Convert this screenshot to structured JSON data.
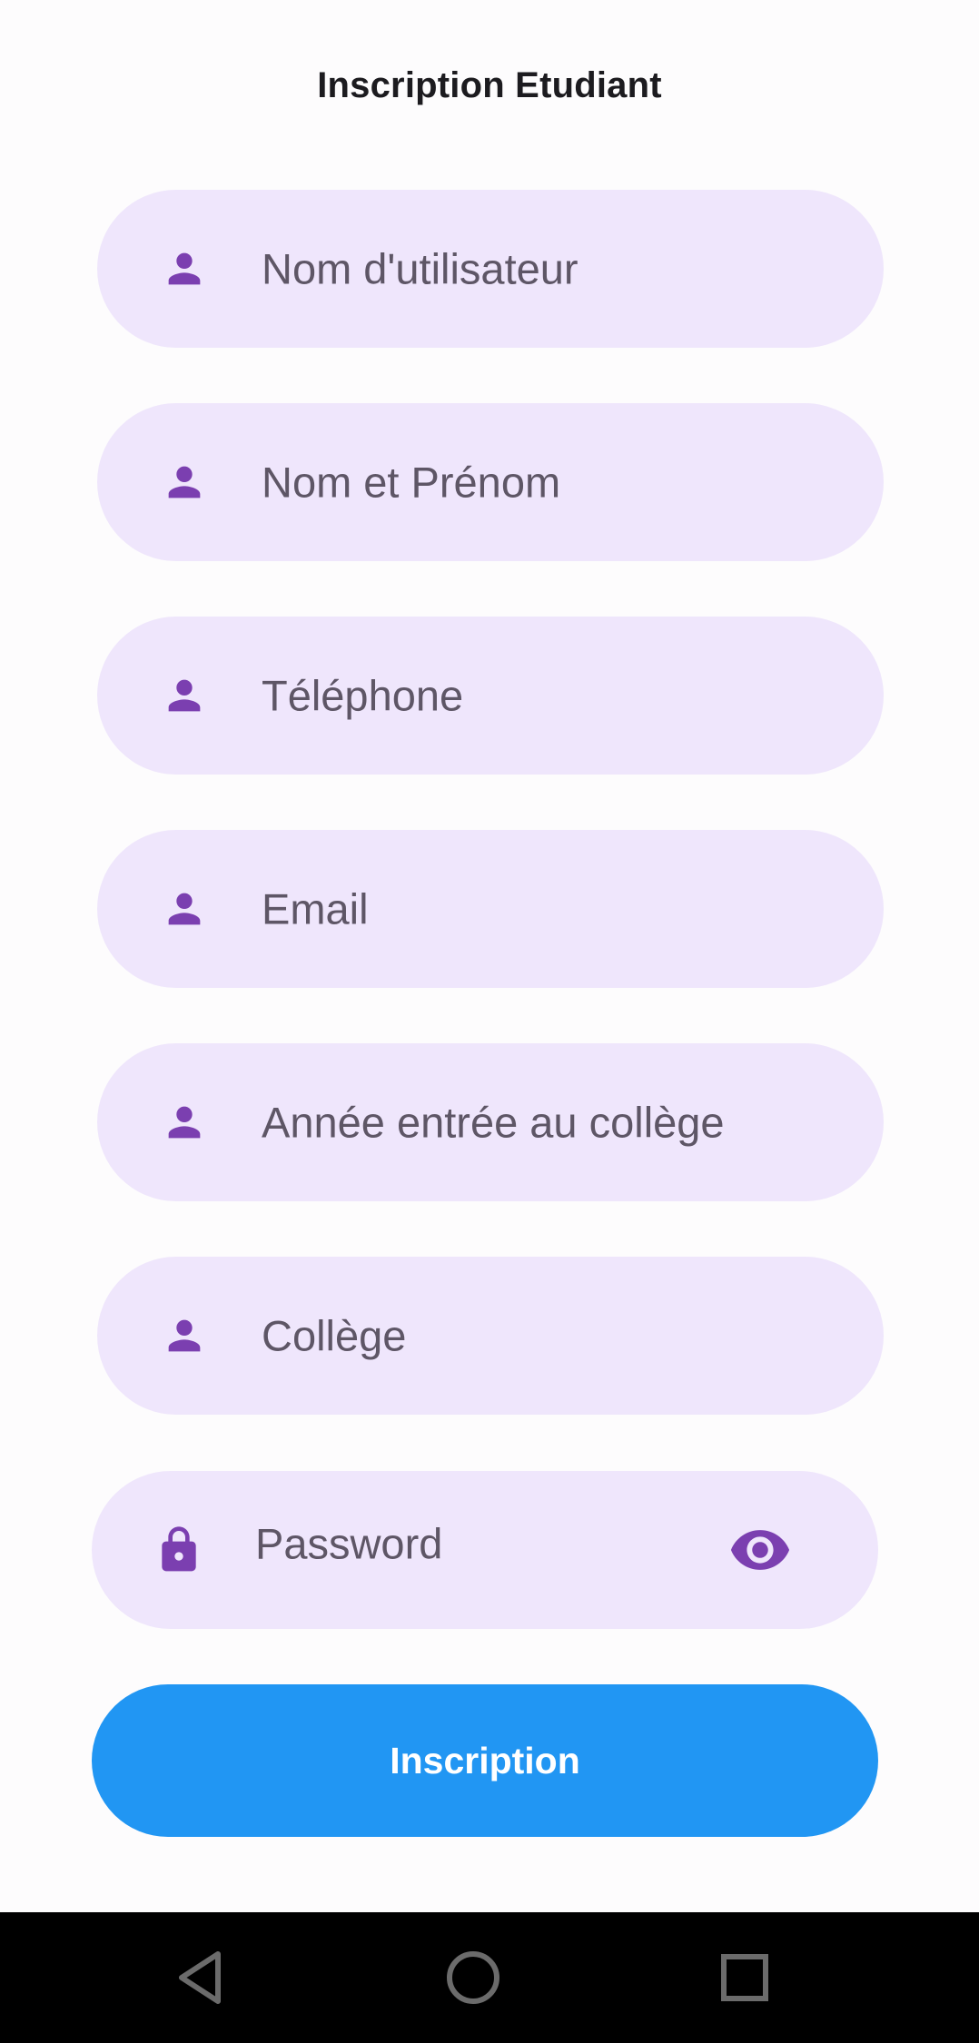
{
  "header": {
    "title": "Inscription Etudiant"
  },
  "form": {
    "fields": [
      {
        "placeholder": "Nom d'utilisateur",
        "icon": "person-icon"
      },
      {
        "placeholder": "Nom et Prénom",
        "icon": "person-icon"
      },
      {
        "placeholder": "Téléphone",
        "icon": "person-icon"
      },
      {
        "placeholder": "Email",
        "icon": "person-icon"
      },
      {
        "placeholder": "Année entrée au collège",
        "icon": "person-icon"
      },
      {
        "placeholder": "Collège",
        "icon": "person-icon"
      }
    ],
    "password": {
      "placeholder": "Password",
      "icon": "lock-icon",
      "toggle_icon": "eye-icon"
    },
    "submit_label": "Inscription"
  },
  "navbar": {
    "icons": [
      "back-triangle-icon",
      "home-circle-icon",
      "recents-square-icon"
    ]
  },
  "colors": {
    "accent": "#7b3fb0",
    "field_bg": "#efe6fc",
    "button_bg": "#2196f3",
    "placeholder_text": "#5e5666"
  }
}
